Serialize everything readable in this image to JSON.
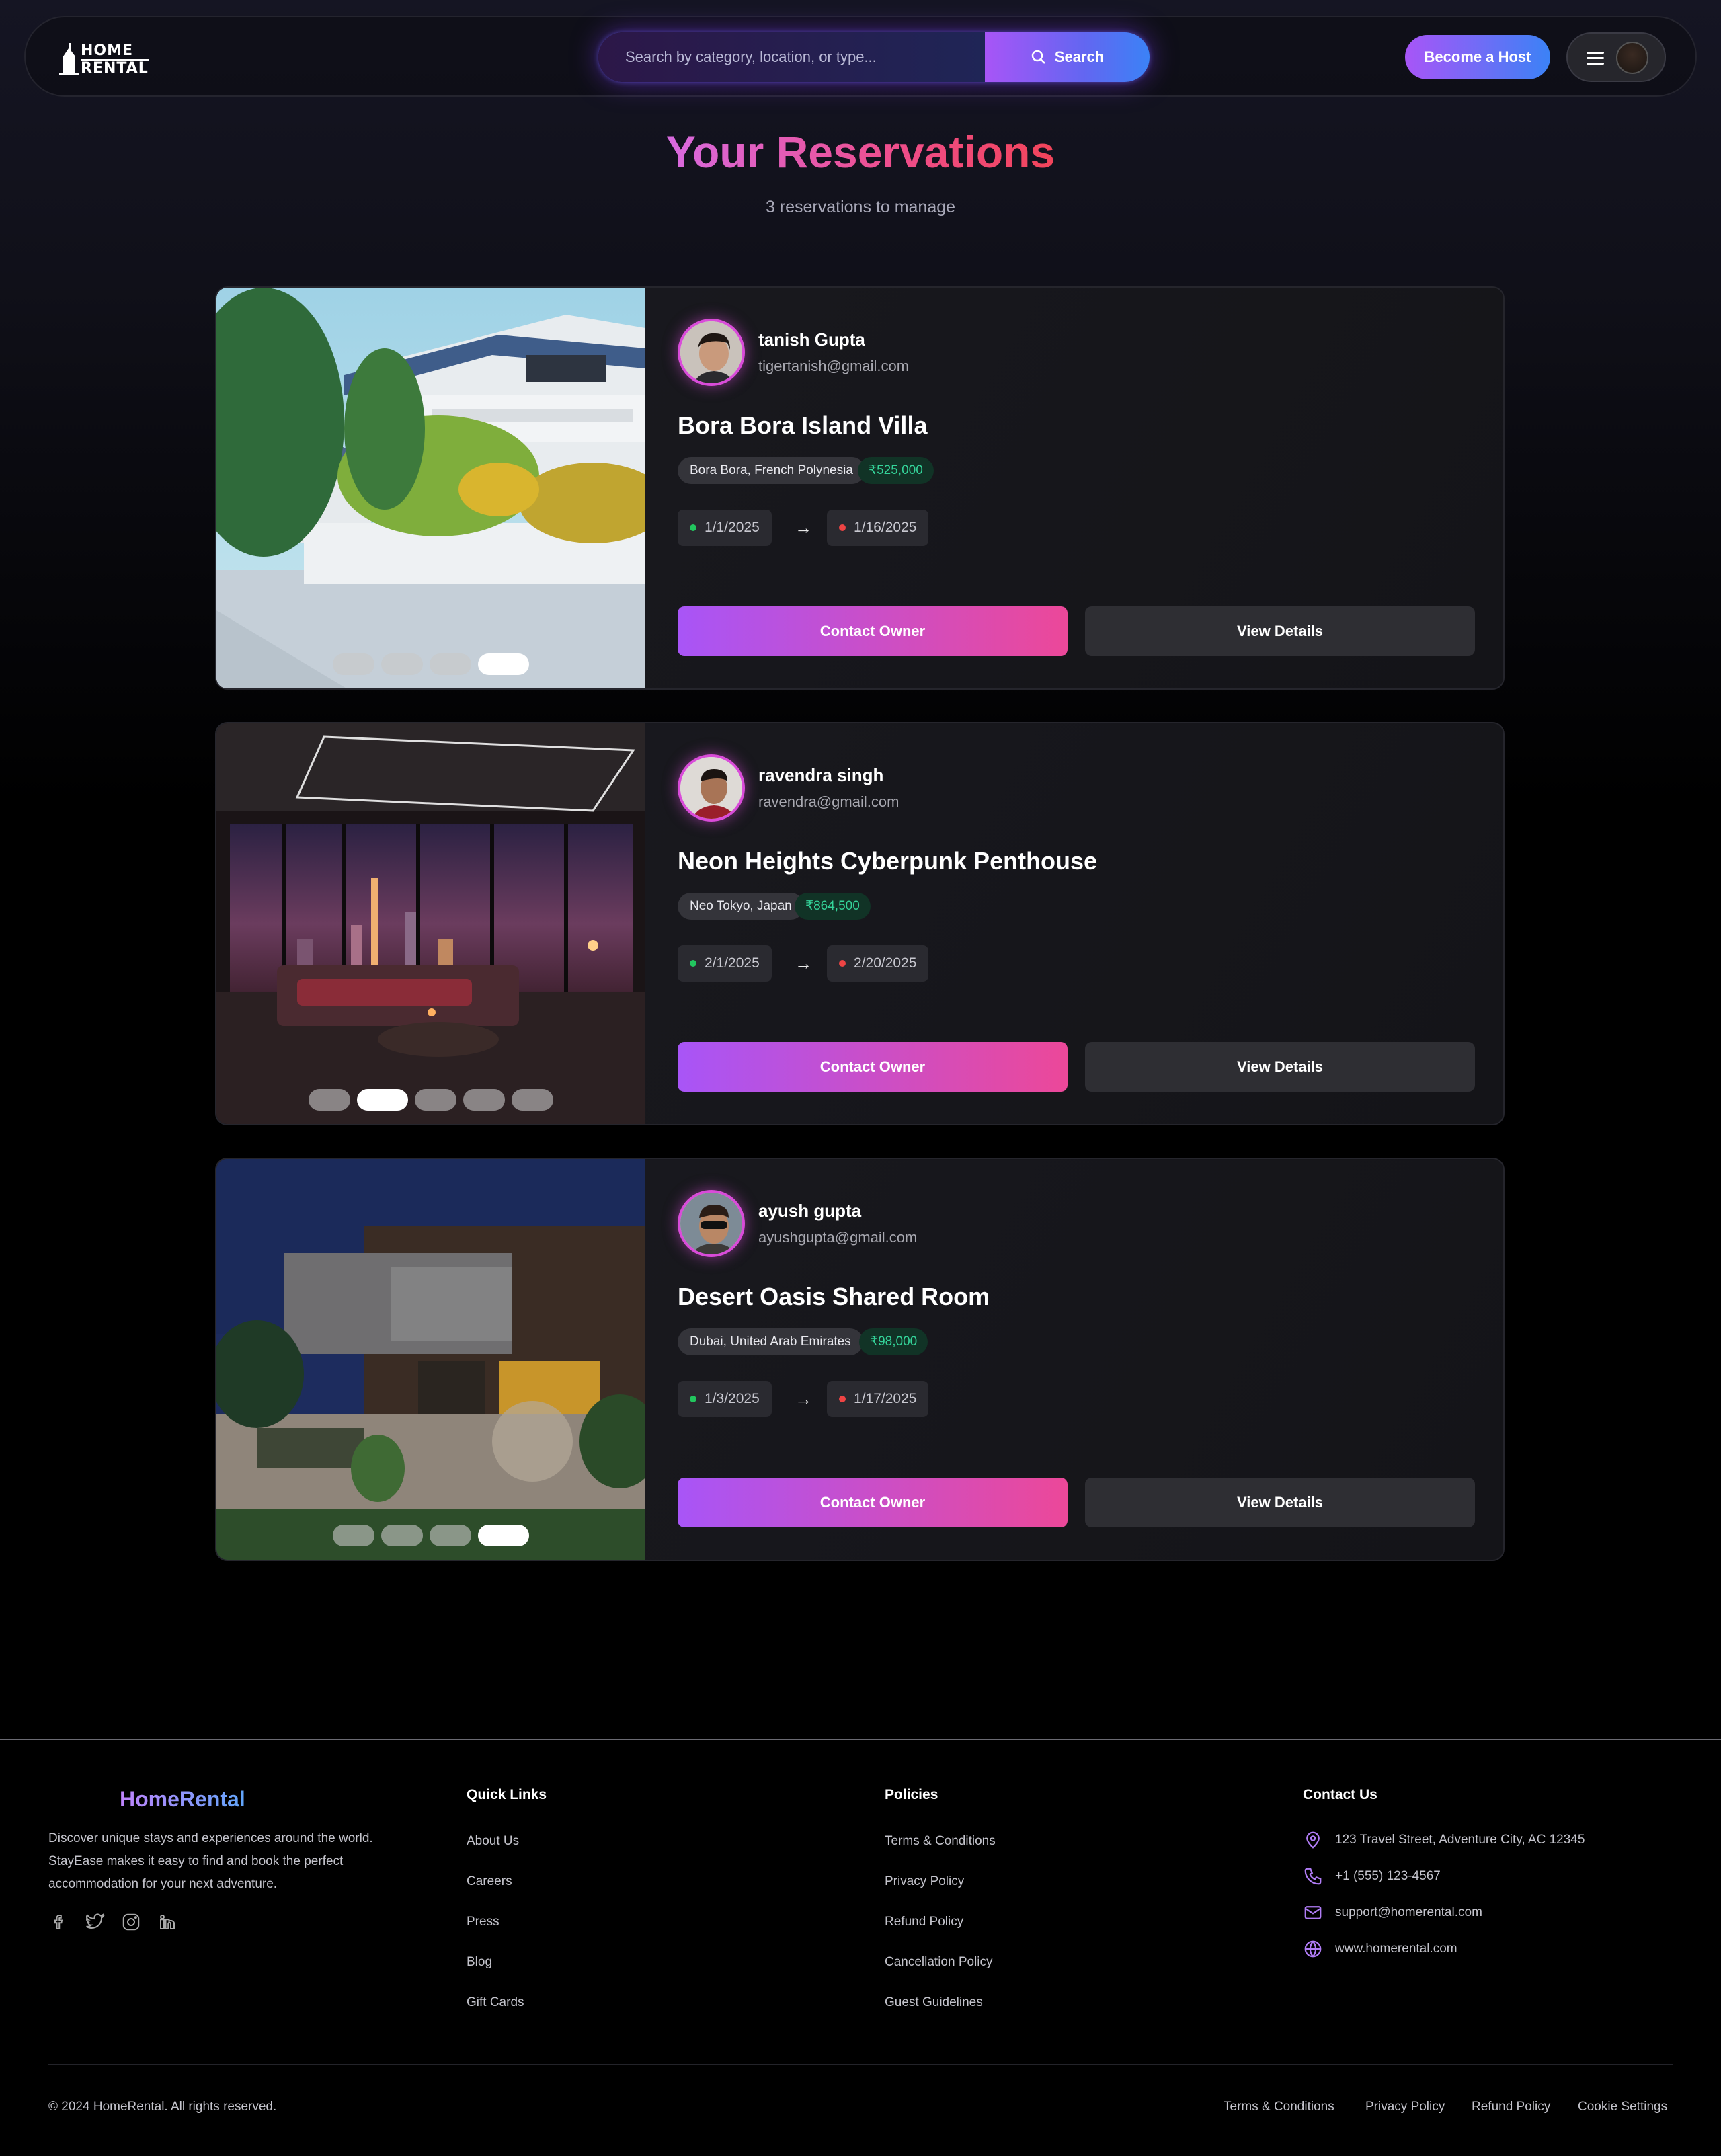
{
  "navbar": {
    "logo": {
      "line1": "HOME",
      "line2": "RENTAL"
    },
    "search": {
      "placeholder": "Search by category, location, or type...",
      "button_label": "Search"
    },
    "host_button": "Become a Host",
    "icons": {
      "menu": "hamburger-menu-icon",
      "search": "search-icon"
    }
  },
  "header": {
    "title": "Your Reservations",
    "subtitle": "3 reservations to manage"
  },
  "reservations": [
    {
      "owner_name": "tanish Gupta",
      "owner_email": "tigertanish@gmail.com",
      "title": "Bora Bora Island Villa",
      "location": "Bora Bora, French Polynesia",
      "price": "₹525,000",
      "check_in": "1/1/2025",
      "check_out": "1/16/2025",
      "arrow": "→",
      "contact_label": "Contact Owner",
      "details_label": "View Details",
      "image_count": 4,
      "active_image": 4
    },
    {
      "owner_name": "ravendra singh",
      "owner_email": "ravendra@gmail.com",
      "title": "Neon Heights Cyberpunk Penthouse",
      "location": "Neo Tokyo, Japan",
      "price": "₹864,500",
      "check_in": "2/1/2025",
      "check_out": "2/20/2025",
      "arrow": "→",
      "contact_label": "Contact Owner",
      "details_label": "View Details",
      "image_count": 5,
      "active_image": 2
    },
    {
      "owner_name": "ayush gupta",
      "owner_email": "ayushgupta@gmail.com",
      "title": "Desert Oasis Shared Room",
      "location": "Dubai, United Arab Emirates",
      "price": "₹98,000",
      "check_in": "1/3/2025",
      "check_out": "1/17/2025",
      "arrow": "→",
      "contact_label": "Contact Owner",
      "details_label": "View Details",
      "image_count": 4,
      "active_image": 4
    }
  ],
  "footer": {
    "brand": "HomeRental",
    "description": "Discover unique stays and experiences around the world. StayEase makes it easy to find and book the perfect accommodation for your next adventure.",
    "social_icons": [
      "facebook-icon",
      "twitter-icon",
      "instagram-icon",
      "linkedin-icon"
    ],
    "quick_links": {
      "title": "Quick Links",
      "items": [
        "About Us",
        "Careers",
        "Press",
        "Blog",
        "Gift Cards"
      ]
    },
    "policies": {
      "title": "Policies",
      "items": [
        "Terms & Conditions",
        "Privacy Policy",
        "Refund Policy",
        "Cancellation Policy",
        "Guest Guidelines"
      ]
    },
    "contact": {
      "title": "Contact Us",
      "address": "123 Travel Street, Adventure City, AC 12345",
      "phone": "+1 (555) 123-4567",
      "email": "support@homerental.com",
      "website": "www.homerental.com"
    },
    "copyright": "© 2024 HomeRental. All rights reserved.",
    "bottom_links": [
      "Terms & Conditions",
      "Privacy Policy",
      "Refund Policy",
      "Cookie Settings"
    ]
  },
  "colors": {
    "accent_purple": "#a855f7",
    "accent_pink": "#ec4899",
    "accent_blue": "#3b82f6",
    "price_green": "#34d399",
    "checkin_dot": "#22c55e",
    "checkout_dot": "#ef4444"
  }
}
